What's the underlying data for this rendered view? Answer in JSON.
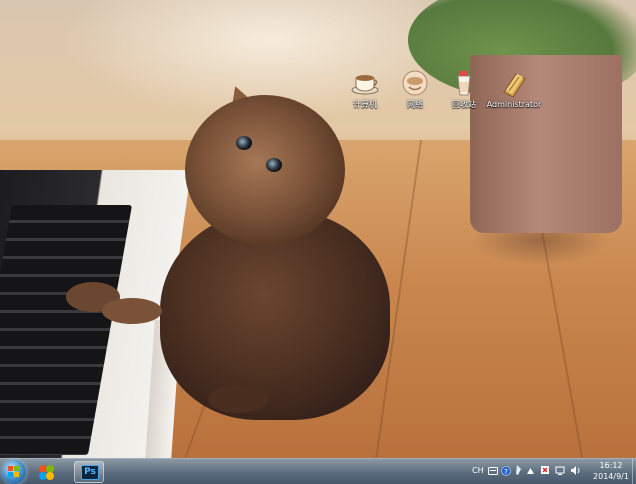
{
  "desktop": {
    "icons": [
      {
        "label": "计算机",
        "icon": "computer-icon"
      },
      {
        "label": "网络",
        "icon": "network-icon"
      },
      {
        "label": "回收站",
        "icon": "recycle-bin-icon"
      },
      {
        "label": "Administrator",
        "icon": "user-folder-icon"
      }
    ]
  },
  "taskbar": {
    "start_icon": "windows-start-icon",
    "pinned": [
      {
        "name": "explorer-pinned",
        "icon": "windows-orb-icon"
      },
      {
        "name": "photoshop",
        "label": "Ps",
        "icon": "photoshop-icon"
      }
    ],
    "tray": {
      "language": "CH",
      "icons": [
        "keyboard-icon",
        "help-icon",
        "pen-icon",
        "expand-arrow-icon",
        "flag-icon",
        "network-status-icon",
        "volume-icon"
      ]
    },
    "clock": {
      "time": "16:12",
      "date": "2014/9/1"
    }
  },
  "colors": {
    "taskbar": "#46627d",
    "ps_accent": "#59b9ff"
  }
}
